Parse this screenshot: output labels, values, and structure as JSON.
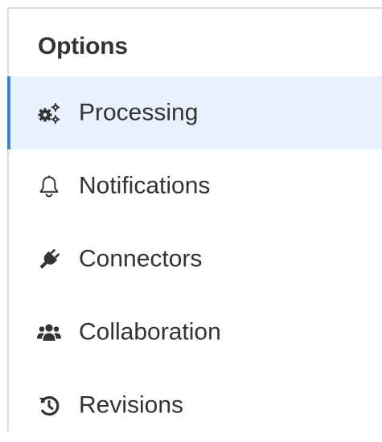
{
  "panel": {
    "title": "Options",
    "items": [
      {
        "label": "Processing",
        "icon": "cogs-icon",
        "active": true
      },
      {
        "label": "Notifications",
        "icon": "bell-icon",
        "active": false
      },
      {
        "label": "Connectors",
        "icon": "plug-icon",
        "active": false
      },
      {
        "label": "Collaboration",
        "icon": "users-icon",
        "active": false
      },
      {
        "label": "Revisions",
        "icon": "history-icon",
        "active": false
      }
    ]
  },
  "colors": {
    "active_background": "#e9f2fc",
    "active_indicator": "#3a83d6",
    "border": "#dedede",
    "text": "#333333"
  }
}
